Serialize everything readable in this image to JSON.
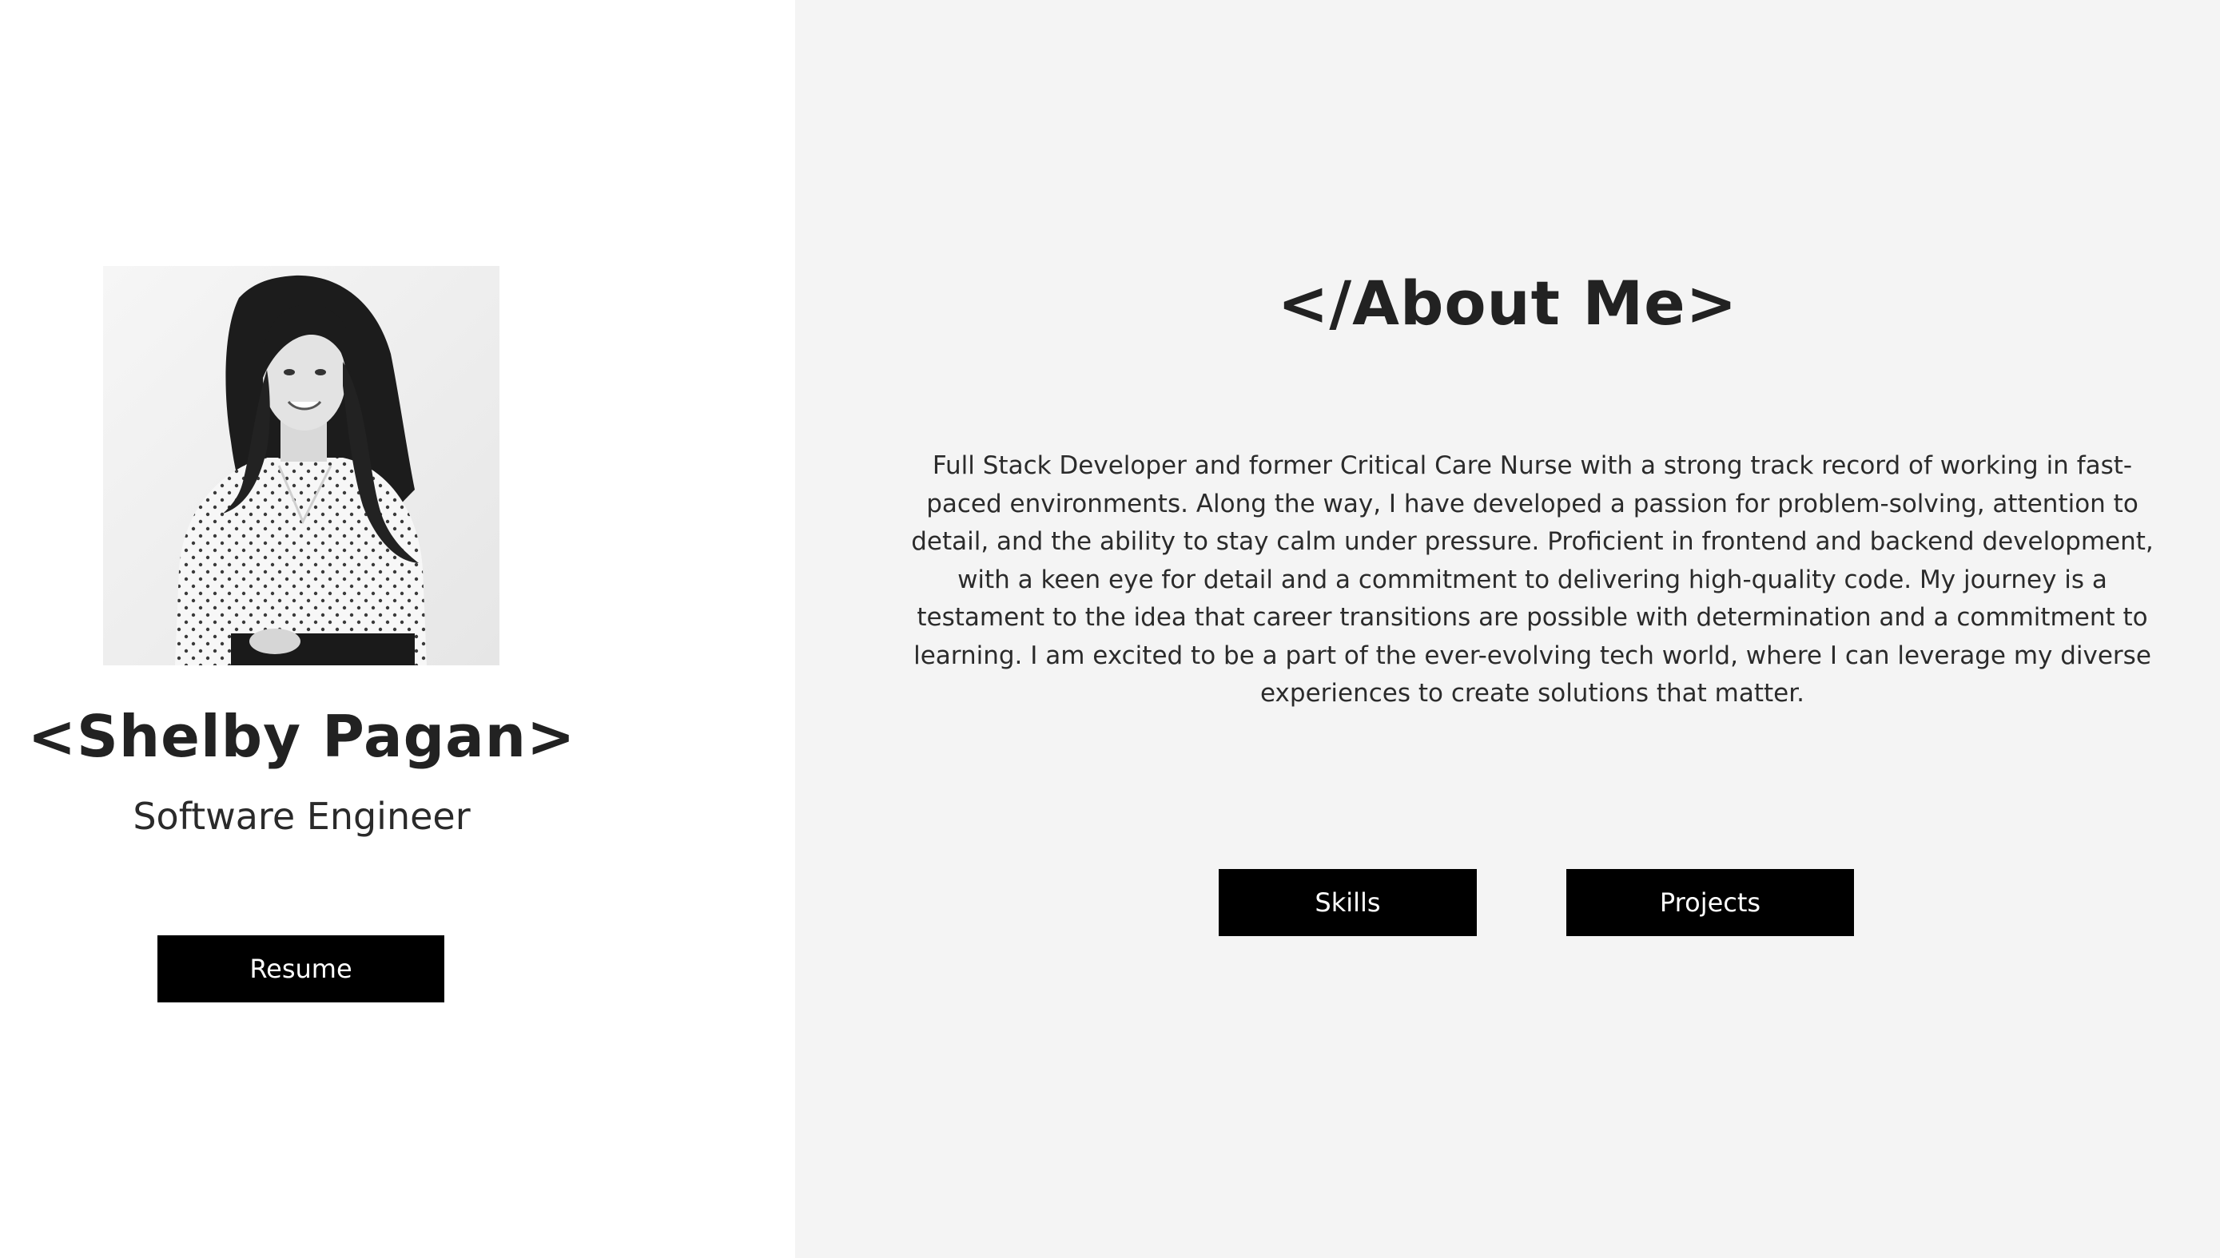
{
  "profile": {
    "name": "<Shelby Pagan>",
    "role": "Software Engineer",
    "photo_icon": "portrait-photo"
  },
  "buttons": {
    "resume": "Resume",
    "skills": "Skills",
    "projects": "Projects"
  },
  "about": {
    "title": "</About Me>",
    "body": "Full Stack Developer and former Critical Care Nurse with a strong track record of working in fast-paced environments. Along the way, I have developed a passion for problem-solving, attention to detail, and the ability to stay calm under pressure. Proficient in frontend and backend development, with a keen eye for detail and a commitment to delivering high-quality code. My journey is a testament to the idea that career transitions are possible with determination and a commitment to learning. I am excited to be a part of the ever-evolving tech world, where I can leverage my diverse experiences to create solutions that matter."
  },
  "colors": {
    "left_background": "#ffffff",
    "right_background": "#f4f4f4",
    "button_background": "#000000",
    "button_text": "#ffffff",
    "heading_text": "#222222"
  }
}
